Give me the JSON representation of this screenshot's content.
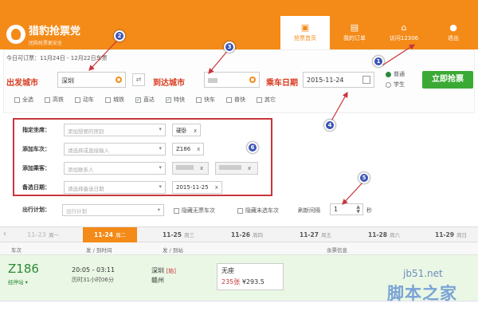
{
  "header": {
    "app_name": "猎豹抢票党",
    "app_sub": "团购抢票更安全",
    "nav": [
      {
        "label": "抢票首页",
        "icon": "train-icon"
      },
      {
        "label": "我的订单",
        "icon": "document-icon"
      },
      {
        "label": "访问12306",
        "icon": "home-icon"
      },
      {
        "label": "退出",
        "icon": "user-icon"
      }
    ]
  },
  "search": {
    "presale_info": "今日可订票：11月24日 - 12月22日车票",
    "from_label": "出发城市",
    "from_value": "深圳",
    "to_label": "到达城市",
    "to_value": "",
    "date_label": "乘车日期",
    "date_value": "2015-11-24",
    "ticket_types": [
      "普通",
      "学生"
    ],
    "submit_label": "立即抢票",
    "train_filters": [
      "全选",
      "高铁",
      "动车",
      "城铁",
      "直达",
      "特快",
      "快车",
      "普快",
      "其它"
    ]
  },
  "form": {
    "seat_label": "指定坐席：",
    "seat_placeholder": "添加想要的席别",
    "seat_tag": "硬卧",
    "train_label": "添加车次：",
    "train_placeholder": "请选择或直接输入",
    "train_tag": "Z186",
    "passenger_label": "添加乘客：",
    "passenger_placeholder": "添加联系人",
    "date_label": "备选日期：",
    "date_placeholder": "请选择备选日期",
    "date_tag": "2015-11-25",
    "remove_glyph": "x"
  },
  "plan": {
    "label": "出行计划：",
    "placeholder": "出行计划",
    "hide_none": "隐藏无票车次",
    "hide_unselected": "隐藏未选车次",
    "refresh_label": "刷新间隔",
    "refresh_value": "1",
    "refresh_unit": "秒"
  },
  "dates": [
    {
      "date": "11-23",
      "weekday": "周一"
    },
    {
      "date": "11-24",
      "weekday": "周二"
    },
    {
      "date": "11-25",
      "weekday": "周三"
    },
    {
      "date": "11-26",
      "weekday": "周四"
    },
    {
      "date": "11-27",
      "weekday": "周五"
    },
    {
      "date": "11-28",
      "weekday": "周六"
    },
    {
      "date": "11-29",
      "weekday": "周日"
    }
  ],
  "table": {
    "headers": [
      "车次",
      "发 / 到时间",
      "发 / 到站",
      "余票信息"
    ],
    "row": {
      "train": "Z186",
      "via": "经停站",
      "times": "20:05 - 03:11",
      "duration": "历时31小时06分",
      "from_station": "深圳",
      "start_tag": "[始]",
      "to_station": "赣州",
      "seat_type": "无座",
      "remaining": "235张",
      "price": "¥293.5"
    }
  },
  "annotations": [
    "1",
    "2",
    "3",
    "4",
    "5",
    "6"
  ],
  "watermark": {
    "site": "jb51.net",
    "name": "脚本之家"
  },
  "colors": {
    "brand": "#f48a17",
    "accent_green": "#3aaa35",
    "highlight_red": "#c9353b",
    "annotation_blue": "#3a53b5"
  }
}
